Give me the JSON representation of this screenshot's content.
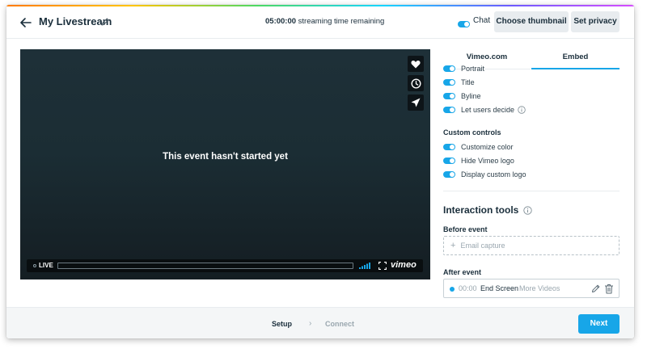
{
  "header": {
    "title": "My Livestream",
    "time_remaining": "05:00:00",
    "time_remaining_suffix": " streaming time remaining",
    "chat_label": "Chat",
    "choose_thumbnail_label": "Choose thumbnail",
    "set_privacy_label": "Set privacy"
  },
  "player": {
    "message": "This event hasn't started yet",
    "live_label": "LIVE",
    "brand": "vimeo",
    "side_buttons": [
      "heart-icon",
      "clock-icon",
      "send-icon"
    ]
  },
  "panel": {
    "tabs": [
      {
        "label": "Vimeo.com",
        "active": false
      },
      {
        "label": "Embed",
        "active": true
      }
    ],
    "options": [
      {
        "label": "Portrait",
        "enabled": true
      },
      {
        "label": "Title",
        "enabled": true
      },
      {
        "label": "Byline",
        "enabled": true
      },
      {
        "label": "Let users decide",
        "enabled": true
      }
    ],
    "custom_controls_heading": "Custom controls",
    "custom_controls": [
      {
        "label": "Customize color",
        "enabled": true
      },
      {
        "label": "Hide Vimeo logo",
        "enabled": true
      },
      {
        "label": "Display custom logo",
        "enabled": true
      }
    ],
    "interaction_tools_heading": "Interaction tools",
    "before_event_heading": "Before event",
    "email_capture_label": "Email capture",
    "after_event_heading": "After event",
    "after_event_item": {
      "time": "00:00",
      "name": "End Screen",
      "detail": "More Videos"
    }
  },
  "footer": {
    "steps": [
      {
        "label": "Setup",
        "active": true
      },
      {
        "label": "Connect",
        "active": false
      }
    ],
    "separator": "›",
    "next_label": "Next"
  },
  "colors": {
    "accent": "#17a6e8",
    "text": "#1a2e3b",
    "muted": "#9aa7af"
  }
}
